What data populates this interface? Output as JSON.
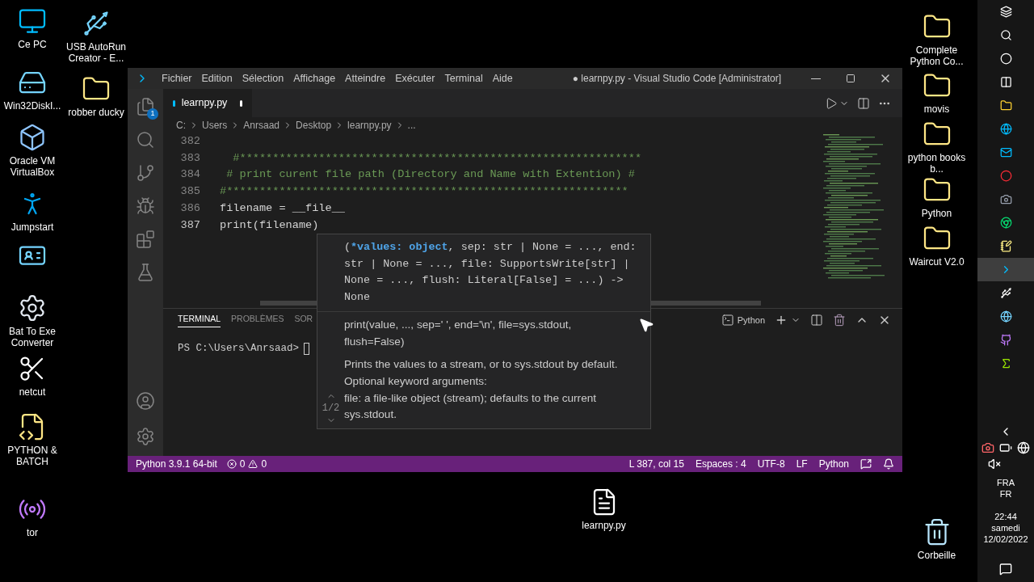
{
  "desktop": {
    "icons": [
      {
        "label": "Ce PC",
        "kind": "pc"
      },
      {
        "label": "USB AutoRun Creator - E...",
        "kind": "usb"
      },
      {
        "label": "Win32DiskI...",
        "kind": "disk"
      },
      {
        "label": "robber ducky",
        "kind": "folder"
      },
      {
        "label": "Oracle VM VirtualBox",
        "kind": "vbox"
      },
      {
        "label": "Jumpstart",
        "kind": "figure"
      },
      {
        "kind": "card"
      },
      {
        "label": "Bat To Exe Converter",
        "kind": "gear"
      },
      {
        "label": "netcut",
        "kind": "scissors"
      },
      {
        "label": "PYTHON & BATCH",
        "kind": "doc"
      },
      {
        "label": "tor",
        "kind": "tor"
      },
      {
        "label": "Complete Python Co...",
        "kind": "folder"
      },
      {
        "label": "movis",
        "kind": "folder"
      },
      {
        "label": "python books b...",
        "kind": "folder"
      },
      {
        "label": "Python",
        "kind": "folder"
      },
      {
        "label": "Waircut V2.0",
        "kind": "folder"
      },
      {
        "label": "learnpy.py",
        "kind": "file"
      },
      {
        "label": "Corbeille",
        "kind": "bin"
      }
    ]
  },
  "window": {
    "title": "● learnpy.py - Visual Studio Code [Administrator]",
    "menu": [
      "Fichier",
      "Edition",
      "Sélection",
      "Affichage",
      "Atteindre",
      "Exécuter",
      "Terminal",
      "Aide"
    ],
    "activity_bar": [
      {
        "kind": "explorer",
        "badge": "1"
      },
      {
        "kind": "search"
      },
      {
        "kind": "scm"
      },
      {
        "kind": "run"
      },
      {
        "kind": "extensions"
      },
      {
        "kind": "testing"
      }
    ],
    "activity_bottom": [
      {
        "kind": "account"
      },
      {
        "kind": "settings"
      }
    ],
    "tabs": [
      {
        "label": "learnpy.py",
        "selected": true,
        "modified": true
      }
    ],
    "breadcrumb": [
      "C:",
      "Users",
      "Anrsaad",
      "Desktop",
      "learnpy.py",
      "..."
    ],
    "code_lines": [
      {
        "number": "382"
      },
      {
        "number": "383",
        "text": "  #*************************************************************",
        "kind": "comment"
      },
      {
        "number": "384",
        "text": " # print curent file path (Directory and Name with Extention) #",
        "kind": "comment"
      },
      {
        "number": "385",
        "text": "#*************************************************************",
        "kind": "comment"
      },
      {
        "number": "386",
        "text": "filename = __file__",
        "kind": "code"
      },
      {
        "number": "387",
        "text": "print(filename)",
        "kind": "code"
      }
    ],
    "hover": {
      "signature": [
        {
          "text": "(",
          "active": false
        },
        {
          "text": "*values: object",
          "active": true
        },
        {
          "text": ", sep: str | None = ..., end: str | None = ..., file: SupportsWrite[str] | None = ..., flush: Literal[False] = ...) -> None",
          "active": false
        }
      ],
      "pager": "1/2",
      "doc": [
        "print(value, ..., sep=' ', end='\\n', file=sys.stdout, flush=False)",
        "Prints the values to a stream, or to sys.stdout by default. Optional keyword arguments:\nfile: a file-like object (stream); defaults to the current sys.stdout."
      ]
    },
    "panel": {
      "tabs": [
        {
          "label": "TERMINAL",
          "selected": true
        },
        {
          "label": "PROBLÈMES",
          "selected": false
        },
        {
          "label": "SOR",
          "selected": false
        }
      ],
      "terminal_name": "Python",
      "prompt": "PS C:\\Users\\Anrsaad>"
    },
    "status_bar": {
      "interpreter": "Python 3.9.1 64-bit",
      "errors": "0",
      "warnings": "0",
      "right": [
        "L 387, col 15",
        "Espaces : 4",
        "UTF-8",
        "LF",
        "Python"
      ]
    }
  },
  "taskbar": {
    "apps": [
      {
        "kind": "windows",
        "selected": false
      },
      {
        "kind": "search",
        "selected": false
      },
      {
        "kind": "cortana",
        "selected": false
      },
      {
        "kind": "taskview",
        "selected": false
      },
      {
        "kind": "explorer",
        "selected": false
      },
      {
        "kind": "edge",
        "selected": false
      },
      {
        "kind": "mail",
        "selected": false
      },
      {
        "kind": "opera",
        "selected": false
      },
      {
        "kind": "obs",
        "selected": false
      },
      {
        "kind": "chrome",
        "selected": false
      },
      {
        "kind": "notepad",
        "selected": false
      },
      {
        "kind": "vscode",
        "selected": true
      },
      {
        "kind": "usb",
        "selected": false
      },
      {
        "kind": "globe",
        "selected": false
      },
      {
        "kind": "github",
        "selected": false
      },
      {
        "kind": "lambda",
        "selected": false
      }
    ],
    "language": [
      "FRA",
      "FR"
    ],
    "clock": [
      "22:44",
      "samedi",
      "12/02/2022"
    ]
  }
}
